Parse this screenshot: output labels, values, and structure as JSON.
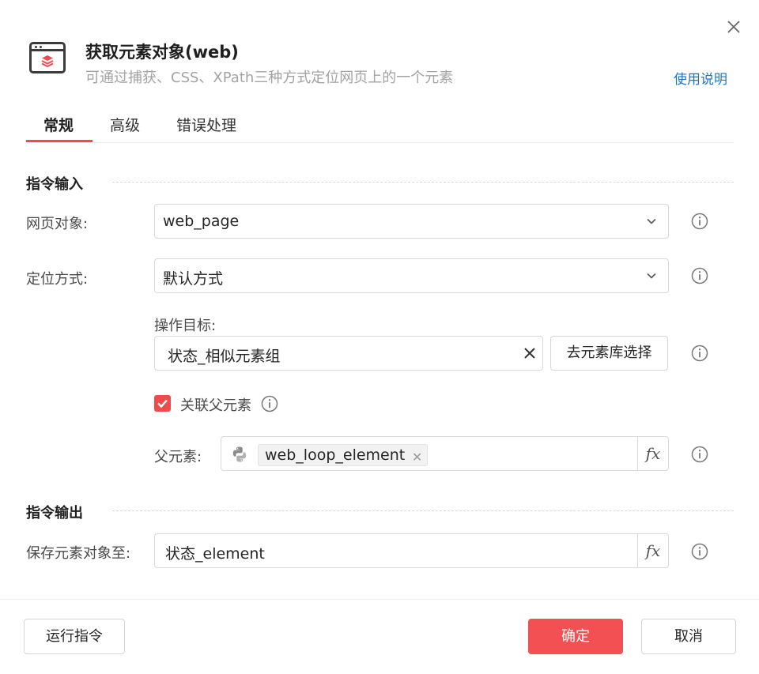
{
  "header": {
    "title": "获取元素对象(web)",
    "subtitle": "可通过捕获、CSS、XPath三种方式定位网页上的一个元素",
    "help_link": "使用说明"
  },
  "tabs": [
    {
      "label": "常规",
      "active": true
    },
    {
      "label": "高级",
      "active": false
    },
    {
      "label": "错误处理",
      "active": false
    }
  ],
  "input_section": {
    "title": "指令输入",
    "web_page": {
      "label": "网页对象:",
      "value": "web_page"
    },
    "locate_method": {
      "label": "定位方式:",
      "value": "默认方式"
    },
    "target": {
      "label": "操作目标:",
      "value": "状态_相似元素组",
      "button": "去元素库选择"
    },
    "parent_checkbox": {
      "label": "关联父元素",
      "checked": true
    },
    "parent_element": {
      "label": "父元素:",
      "tag": "web_loop_element",
      "fx": "fx"
    }
  },
  "output_section": {
    "title": "指令输出",
    "save_to": {
      "label": "保存元素对象至:",
      "value": "状态_element",
      "fx": "fx"
    }
  },
  "footer": {
    "run_button": "运行指令",
    "confirm_button": "确定",
    "cancel_button": "取消"
  },
  "colors": {
    "accent": "#f04b4b",
    "link": "#1677d2"
  }
}
